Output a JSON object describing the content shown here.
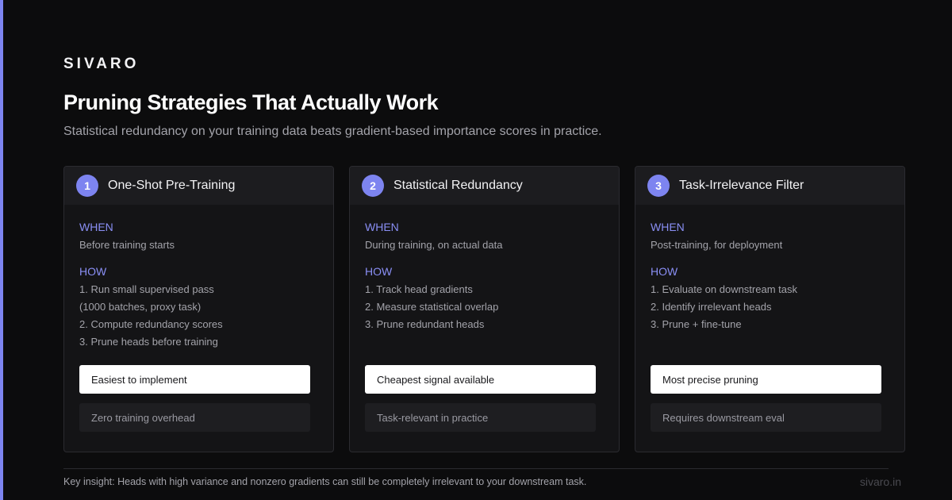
{
  "brand": "SIVARO",
  "title": "Pruning Strategies That Actually Work",
  "subtitle": "Statistical redundancy on your training data beats gradient-based importance scores in practice.",
  "colors": {
    "accent": "#7d84f0",
    "background": "#0c0c0d",
    "card": "#141416",
    "label": "#8a8ff5"
  },
  "labels": {
    "when": "WHEN",
    "how": "HOW"
  },
  "cards": [
    {
      "number": "1",
      "title": "One-Shot Pre-Training",
      "when": "Before training starts",
      "how": [
        "1. Run small supervised pass",
        "(1000 batches, proxy task)",
        "2. Compute redundancy scores",
        "3. Prune heads before training"
      ],
      "pro": "Easiest to implement",
      "con": "Zero training overhead"
    },
    {
      "number": "2",
      "title": "Statistical Redundancy",
      "when": "During training, on actual data",
      "how": [
        "1. Track head gradients",
        "2. Measure statistical overlap",
        "3. Prune redundant heads"
      ],
      "pro": "Cheapest signal available",
      "con": "Task-relevant in practice"
    },
    {
      "number": "3",
      "title": "Task-Irrelevance Filter",
      "when": "Post-training, for deployment",
      "how": [
        "1. Evaluate on downstream task",
        "2. Identify irrelevant heads",
        "3. Prune + fine-tune"
      ],
      "pro": "Most precise pruning",
      "con": "Requires downstream eval"
    }
  ],
  "footer": {
    "insight": "Key insight: Heads with high variance and nonzero gradients can still be completely irrelevant to your downstream task.",
    "site": "sivaro.in"
  }
}
